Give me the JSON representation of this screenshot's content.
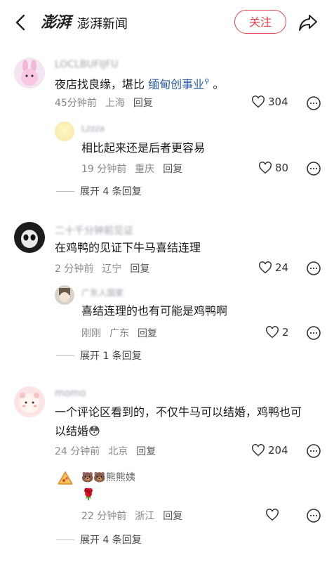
{
  "header": {
    "logo_text": "澎湃",
    "app_name": "澎湃新闻",
    "follow_label": "关注"
  },
  "comments": [
    {
      "username": "LOCLBUFIJFU",
      "text_prefix": "夜店找良缘，堪比 ",
      "text_link": "缅甸创事业",
      "text_suffix": " 。",
      "time": "45分钟前",
      "location": "上海",
      "reply": "回复",
      "likes": "304",
      "sub": {
        "username": "Lzzza",
        "text": "相比起来还是后者更容易",
        "time": "19 分钟前",
        "location": "重庆",
        "reply": "回复",
        "likes": "80"
      },
      "expand": "展开 4 条回复"
    },
    {
      "username": "二十千分钟前见证",
      "text": "在鸡鸭的见证下牛马喜结连理",
      "time": "2 分钟前",
      "location": "辽宁",
      "reply": "回复",
      "likes": "24",
      "sub": {
        "username": "广东人国家",
        "text": "喜结连理的也有可能是鸡鸭啊",
        "time": "刚刚",
        "location": "广东",
        "reply": "回复",
        "likes": "2"
      },
      "expand": "展开 1 条回复"
    },
    {
      "username": "momo",
      "text_line1": "一个评论区看到的，不仅牛马可以结婚，鸡鸭也可",
      "text_line2": "以结婚",
      "time": "24 分钟前",
      "location": "北京",
      "reply": "回复",
      "likes": "204",
      "sub": {
        "username": "熊熊姨",
        "text": "🌹",
        "time": "22 分钟前",
        "location": "浙江",
        "reply": "回复",
        "likes": ""
      },
      "expand": "展开 4 条回复"
    }
  ]
}
